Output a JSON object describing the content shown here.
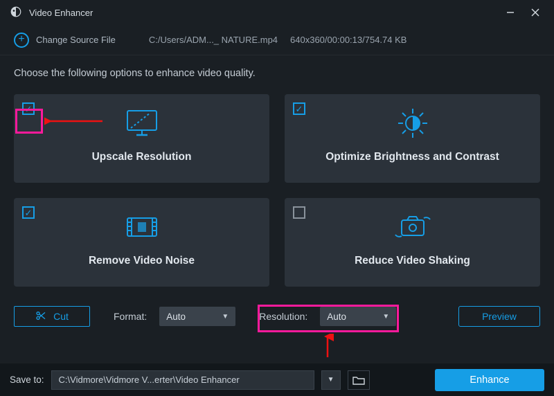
{
  "window": {
    "title": "Video Enhancer"
  },
  "filerow": {
    "change_source_label": "Change Source File",
    "path": "C:/Users/ADM..._ NATURE.mp4",
    "info": "640x360/00:00:13/754.74 KB"
  },
  "instruction": "Choose the following options to enhance video quality.",
  "cards": {
    "upscale": {
      "label": "Upscale Resolution",
      "checked": true
    },
    "bright": {
      "label": "Optimize Brightness and Contrast",
      "checked": true
    },
    "noise": {
      "label": "Remove Video Noise",
      "checked": true
    },
    "shaking": {
      "label": "Reduce Video Shaking",
      "checked": false
    }
  },
  "controls": {
    "cut_label": "Cut",
    "format_label": "Format:",
    "format_value": "Auto",
    "resolution_label": "Resolution:",
    "resolution_value": "Auto",
    "preview_label": "Preview"
  },
  "footer": {
    "save_to_label": "Save to:",
    "path": "C:\\Vidmore\\Vidmore V...erter\\Video Enhancer",
    "enhance_label": "Enhance"
  },
  "colors": {
    "accent": "#169ee6",
    "highlight": "#ff1a9c"
  }
}
